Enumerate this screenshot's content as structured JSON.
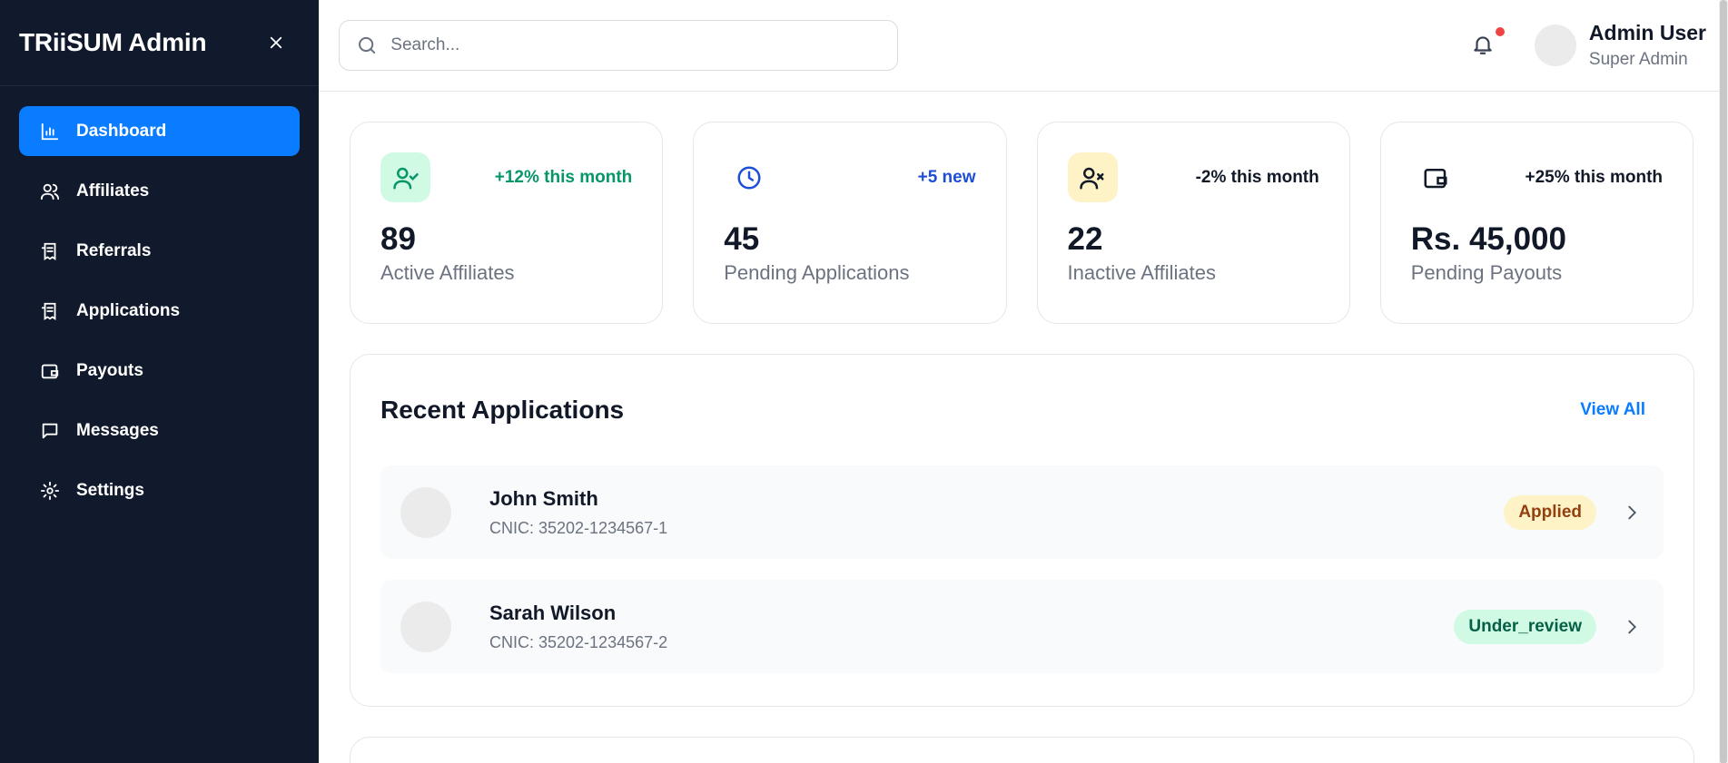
{
  "sidebar": {
    "brand": "TRiiSUM Admin",
    "close_icon": "close-icon",
    "items": [
      {
        "label": "Dashboard",
        "icon": "bar-chart-icon",
        "active": true
      },
      {
        "label": "Affiliates",
        "icon": "users-icon",
        "active": false
      },
      {
        "label": "Referrals",
        "icon": "receipt-icon",
        "active": false
      },
      {
        "label": "Applications",
        "icon": "receipt-icon",
        "active": false
      },
      {
        "label": "Payouts",
        "icon": "wallet-icon",
        "active": false
      },
      {
        "label": "Messages",
        "icon": "message-icon",
        "active": false
      },
      {
        "label": "Settings",
        "icon": "gear-icon",
        "active": false
      }
    ]
  },
  "header": {
    "search_placeholder": "Search...",
    "user_name": "Admin User",
    "user_role": "Super Admin"
  },
  "stats": [
    {
      "delta": "+12% this month",
      "value": "89",
      "label": "Active Affiliates",
      "icon": "user-check-icon",
      "icon_bg": "#d1fae5",
      "icon_color": "#059669",
      "delta_color": "#059669"
    },
    {
      "delta": "+5 new",
      "value": "45",
      "label": "Pending Applications",
      "icon": "clock-icon",
      "icon_bg": "#ffffff",
      "icon_color": "#1d4ed8",
      "delta_color": "#1d4ed8"
    },
    {
      "delta": "-2% this month",
      "value": "22",
      "label": "Inactive Affiliates",
      "icon": "user-x-icon",
      "icon_bg": "#fef3c7",
      "icon_color": "#111827",
      "delta_color": "#111827"
    },
    {
      "delta": "+25% this month",
      "value": "Rs. 45,000",
      "label": "Pending Payouts",
      "icon": "wallet-icon",
      "icon_bg": "#ffffff",
      "icon_color": "#111827",
      "delta_color": "#111827"
    }
  ],
  "recent": {
    "title": "Recent Applications",
    "view_all": "View All",
    "rows": [
      {
        "name": "John Smith",
        "cnic": "CNIC: 35202-1234567-1",
        "status": "Applied"
      },
      {
        "name": "Sarah Wilson",
        "cnic": "CNIC: 35202-1234567-2",
        "status": "Under_review"
      }
    ]
  },
  "colors": {
    "sidebar_bg": "#111a2c",
    "accent": "#0a7cff",
    "notification": "#ef4444"
  }
}
